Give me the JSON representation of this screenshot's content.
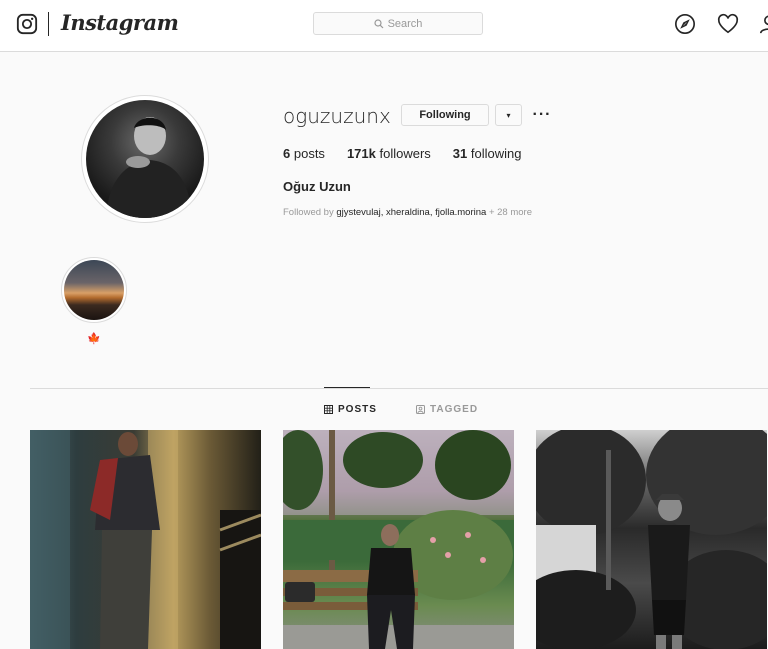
{
  "nav": {
    "wordmark": "Instagram",
    "search_placeholder": "Search",
    "icons": [
      "instagram-glyph-icon",
      "search-icon",
      "compass-icon",
      "heart-icon",
      "person-icon"
    ]
  },
  "profile": {
    "username": "oguzuzunx",
    "following_button": "Following",
    "dropdown_glyph": "▾",
    "more_glyph": "···",
    "stats": [
      {
        "count": "6",
        "label": "posts"
      },
      {
        "count": "171k",
        "label": "followers"
      },
      {
        "count": "31",
        "label": "following"
      }
    ],
    "full_name": "Oğuz Uzun",
    "followed_by_prefix": "Followed by",
    "followed_by_names": "gjystevulaj, xheraldina, fjolla.morina",
    "followed_by_more": "+ 28 more"
  },
  "highlight": {
    "label": "🍁"
  },
  "tabs": [
    {
      "label": "POSTS",
      "icon": "grid-icon",
      "active": true
    },
    {
      "label": "TAGGED",
      "icon": "tagged-icon",
      "active": false
    }
  ],
  "colors": {
    "text": "#262626",
    "muted": "#999999",
    "border": "#dbdbdb",
    "background": "#fafafa"
  }
}
